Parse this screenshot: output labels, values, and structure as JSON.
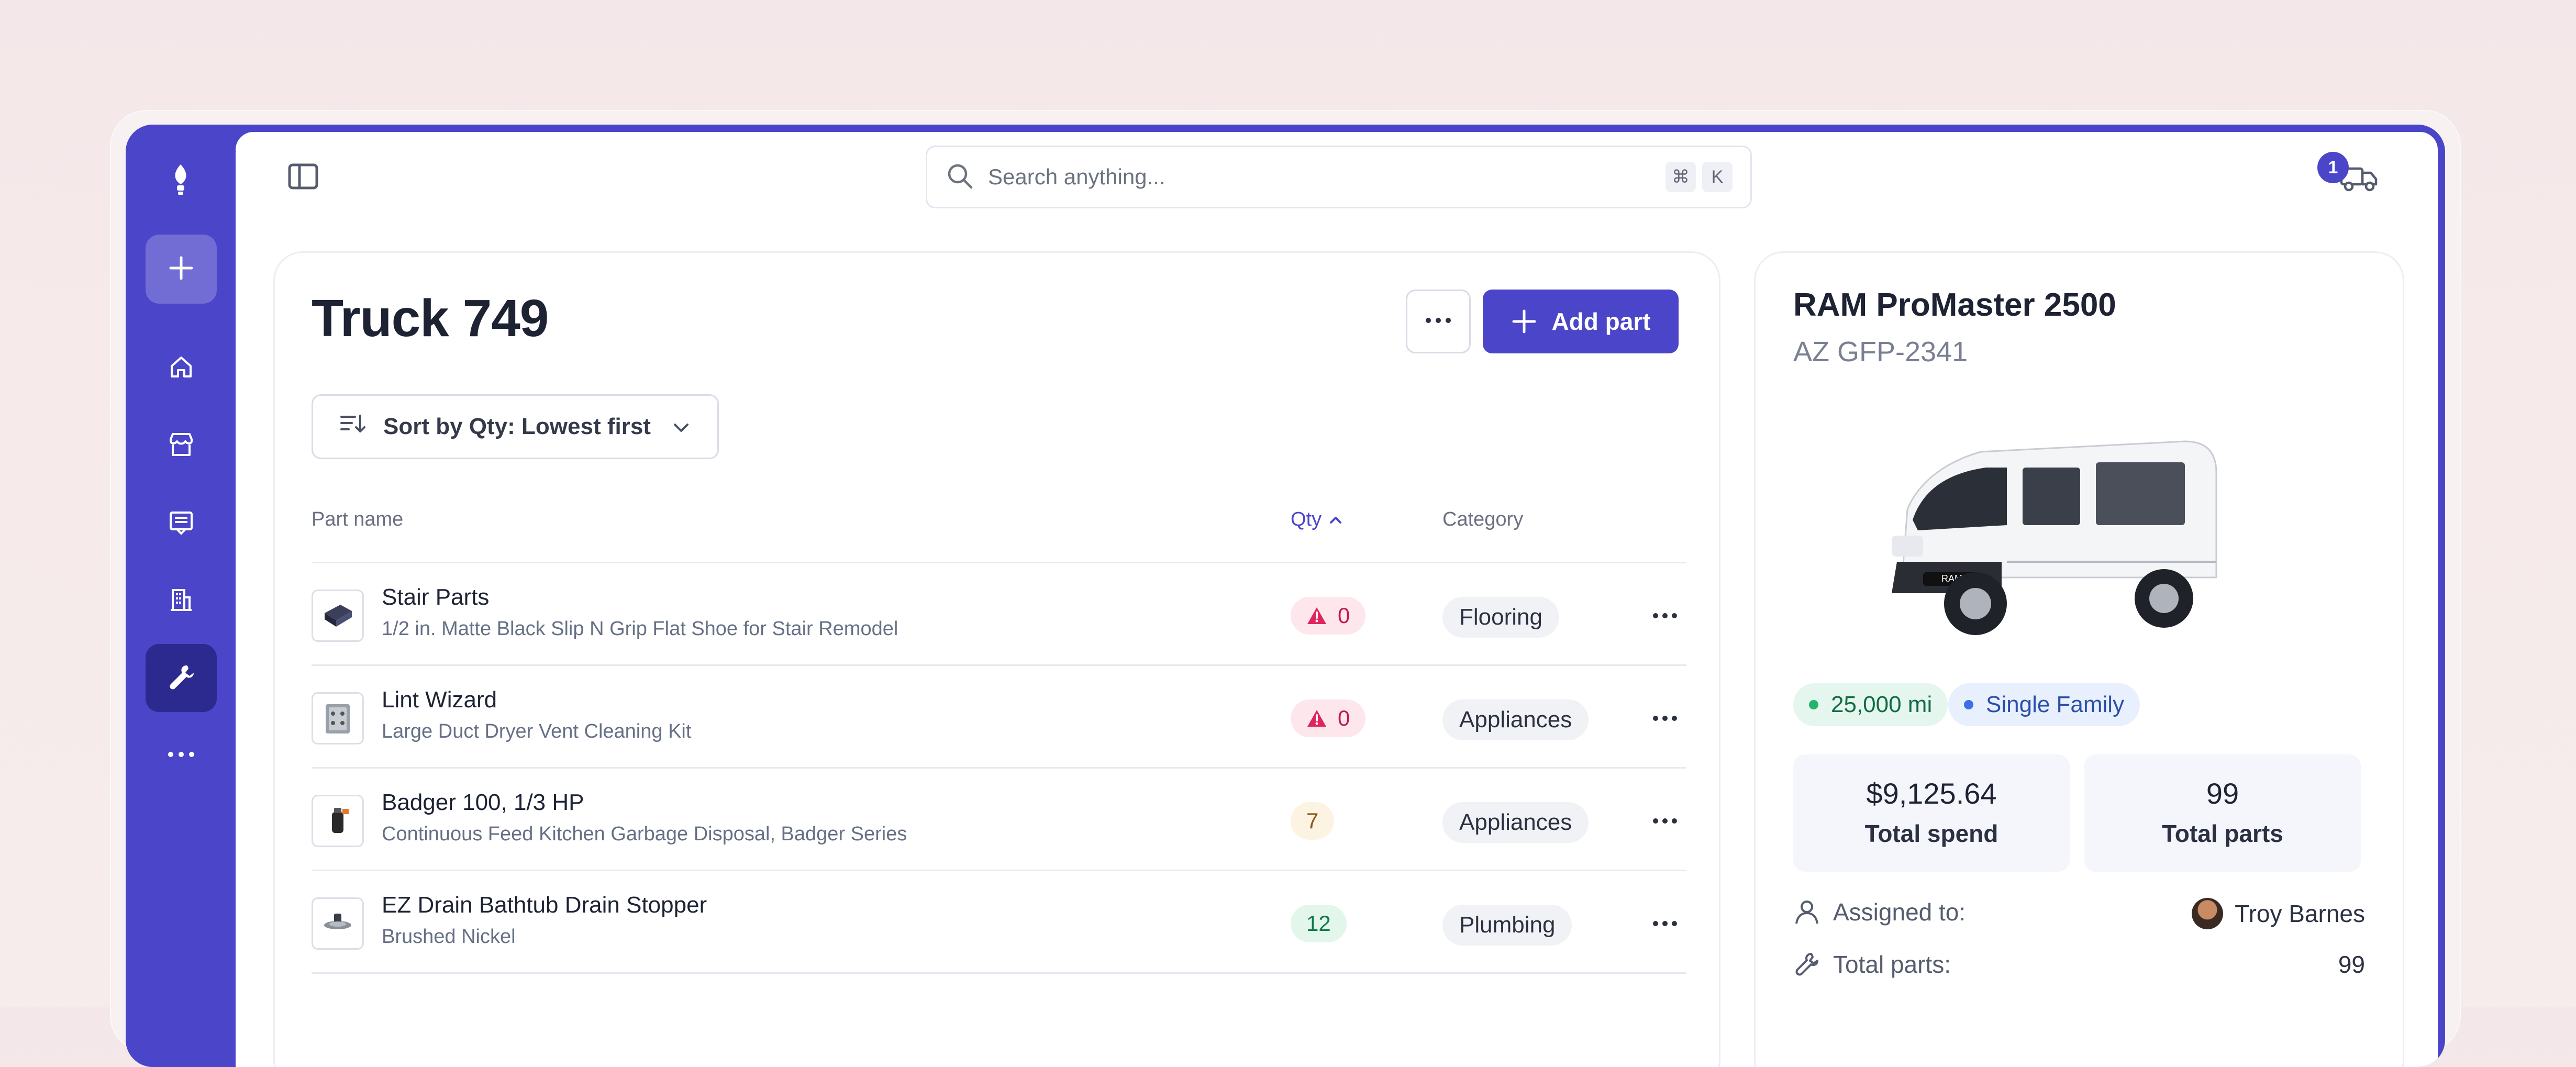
{
  "colors": {
    "accent": "#4a45c9",
    "danger": "#c21a4a",
    "warning": "#8a5a1a",
    "success": "#127a4a",
    "info": "#2a4fa8"
  },
  "sidebar": {
    "logo_icon": "bulb-logo-icon",
    "add_icon": "plus-icon",
    "items": [
      {
        "icon": "home-icon"
      },
      {
        "icon": "store-icon"
      },
      {
        "icon": "receipt-icon"
      },
      {
        "icon": "building-icon"
      },
      {
        "icon": "wrench-icon",
        "active": true
      },
      {
        "icon": "more-icon"
      }
    ]
  },
  "topbar": {
    "search_placeholder": "Search anything...",
    "shortcut_keys": [
      "⌘",
      "K"
    ],
    "notification_count": "1",
    "truck_icon": "truck-icon"
  },
  "parts": {
    "title": "Truck 749",
    "add_label": "Add part",
    "sort_label": "Sort by Qty: Lowest first",
    "columns": {
      "name": "Part name",
      "qty": "Qty",
      "category": "Category"
    },
    "rows": [
      {
        "name": "Stair Parts",
        "desc": "1/2 in. Matte Black Slip N Grip Flat Shoe for Stair Remodel",
        "qty": "0",
        "qty_status": "red",
        "category": "Flooring"
      },
      {
        "name": "Lint Wizard",
        "desc": "Large Duct Dryer Vent Cleaning Kit",
        "qty": "0",
        "qty_status": "red",
        "category": "Appliances"
      },
      {
        "name": "Badger 100, 1/3 HP",
        "desc": "Continuous Feed Kitchen Garbage Disposal, Badger Series",
        "qty": "7",
        "qty_status": "orange",
        "category": "Appliances"
      },
      {
        "name": "EZ Drain Bathtub Drain Stopper",
        "desc": "Brushed Nickel",
        "qty": "12",
        "qty_status": "green",
        "category": "Plumbing"
      }
    ]
  },
  "vehicle": {
    "name": "RAM ProMaster 2500",
    "plate": "AZ GFP-2341",
    "tags": {
      "mileage": "25,000 mi",
      "type": "Single Family"
    },
    "stats": {
      "spend_value": "$9,125.64",
      "spend_label": "Total spend",
      "parts_value": "99",
      "parts_label": "Total parts"
    },
    "details": {
      "assigned_label": "Assigned to:",
      "assigned_value": "Troy Barnes",
      "parts_label": "Total parts:",
      "parts_value": "99"
    }
  }
}
